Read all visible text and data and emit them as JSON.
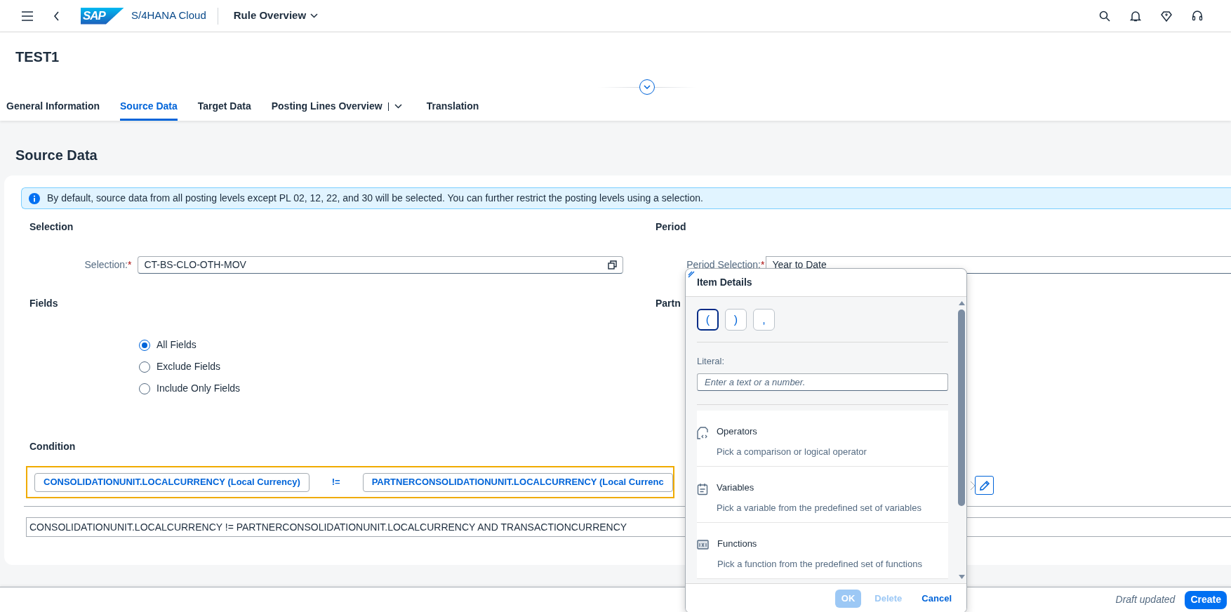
{
  "shell": {
    "logo_text": "SAP",
    "product": "S/4HANA Cloud",
    "app_title": "Rule Overview"
  },
  "header": {
    "title": "TEST1"
  },
  "tabs": [
    {
      "label": "General Information",
      "selected": false,
      "menu": false
    },
    {
      "label": "Source Data",
      "selected": true,
      "menu": false
    },
    {
      "label": "Target Data",
      "selected": false,
      "menu": false
    },
    {
      "label": "Posting Lines Overview",
      "selected": false,
      "menu": true
    },
    {
      "label": "Translation",
      "selected": false,
      "menu": false
    }
  ],
  "section_title": "Source Data",
  "info_message": "By default, source data from all posting levels except PL 02, 12, 22, and 30 will be selected. You can further restrict the posting levels using a selection.",
  "selection": {
    "heading": "Selection",
    "label": "Selection:",
    "required_mark": "*",
    "value": "CT-BS-CLO-OTH-MOV"
  },
  "period": {
    "heading": "Period",
    "label": "Period Selection:",
    "required_mark": "*",
    "value": "Year to Date"
  },
  "fields": {
    "heading": "Fields",
    "options": [
      {
        "label": "All Fields",
        "selected": true
      },
      {
        "label": "Exclude Fields",
        "selected": false
      },
      {
        "label": "Include Only Fields",
        "selected": false
      }
    ]
  },
  "partner_heading": "Partn",
  "condition": {
    "heading": "Condition",
    "tokens": [
      {
        "kind": "field",
        "text": "CONSOLIDATIONUNIT.LOCALCURRENCY (Local Currency)"
      },
      {
        "kind": "operator",
        "text": "!="
      },
      {
        "kind": "field",
        "text": "PARTNERCONSOLIDATIONUNIT.LOCALCURRENCY (Local Currenc"
      }
    ],
    "expression": "CONSOLIDATIONUNIT.LOCALCURRENCY != PARTNERCONSOLIDATIONUNIT.LOCALCURRENCY AND TRANSACTIONCURRENCY"
  },
  "item_details": {
    "title": "Item Details",
    "symbols": [
      {
        "text": "(",
        "selected": true
      },
      {
        "text": ")",
        "selected": false
      },
      {
        "text": ",",
        "selected": false
      }
    ],
    "literal_label": "Literal:",
    "literal_placeholder": "Enter a text or a number.",
    "categories": [
      {
        "kind": "operators",
        "title": "Operators",
        "description": "Pick a comparison or logical operator"
      },
      {
        "kind": "variables",
        "title": "Variables",
        "description": "Pick a variable from the predefined set of variables"
      },
      {
        "kind": "functions",
        "title": "Functions",
        "description": "Pick a function from the predefined set of functions"
      }
    ],
    "buttons": [
      {
        "kind": "emphasized",
        "label": "OK",
        "disabled": true
      },
      {
        "kind": "transparent",
        "label": "Delete",
        "disabled": true
      },
      {
        "kind": "transparent",
        "label": "Cancel",
        "disabled": false
      }
    ]
  },
  "footer": {
    "status": "Draft updated",
    "button": "Create"
  }
}
